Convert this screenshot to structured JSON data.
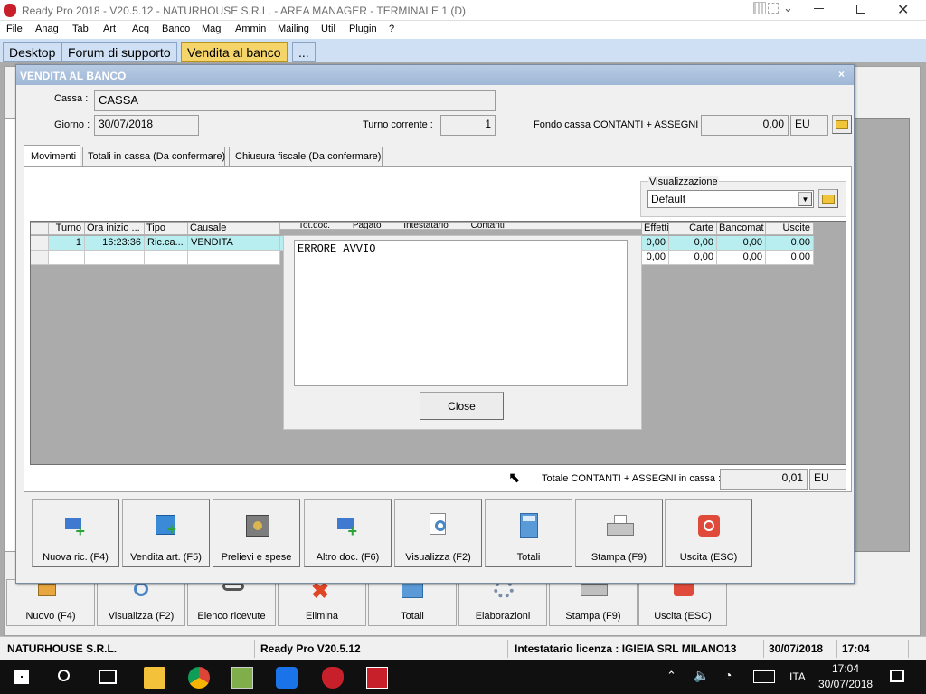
{
  "window": {
    "title": "Ready Pro 2018 - V20.5.12 - NATURHOUSE S.R.L. - AREA MANAGER - TERMINALE 1 (D)"
  },
  "menu": [
    "File",
    "Anag",
    "Tab",
    "Art",
    "Acq",
    "Banco",
    "Mag",
    "Ammin",
    "Mailing",
    "Util",
    "Plugin",
    "?"
  ],
  "tabs": [
    "Desktop",
    "Forum di supporto",
    "Vendita al banco",
    "..."
  ],
  "dialog": {
    "title": "VENDITA AL BANCO",
    "cassa_label": "Cassa :",
    "cassa_value": "CASSA",
    "giorno_label": "Giorno :",
    "giorno_value": "30/07/2018",
    "turno_label": "Turno corrente :",
    "turno_value": "1",
    "fondo_label": "Fondo cassa CONTANTI + ASSEGNI :",
    "fondo_value": "0,00",
    "fondo_currency": "EU",
    "subtabs": [
      "Movimenti",
      "Totali in cassa (Da confermare)",
      "Chiusura fiscale (Da confermare)"
    ],
    "visualizzazione_label": "Visualizzazione",
    "visualizzazione_value": "Default",
    "grid_headers_left": [
      "Turno",
      "Ora inizio ...",
      "Tipo",
      "Causale"
    ],
    "grid_headers_right": [
      "Effetti",
      "Carte",
      "Bancomat",
      "Uscite"
    ],
    "grid_headers_partial": [
      "Tot.doc.",
      "Pagato",
      "Intestatario",
      "Contanti"
    ],
    "row1": {
      "turno": "1",
      "ora": "16:23:36",
      "tipo": "Ric.ca...",
      "causale": "VENDITA",
      "effetti": "0,00",
      "carte": "0,00",
      "bancomat": "0,00",
      "uscite": "0,00"
    },
    "row2": {
      "effetti": "0,00",
      "carte": "0,00",
      "bancomat": "0,00",
      "uscite": "0,00"
    },
    "totale_label": "Totale CONTANTI + ASSEGNI in cassa :",
    "totale_value": "0,01",
    "totale_currency": "EU",
    "buttons": [
      "Nuova ric. (F4)",
      "Vendita art. (F5)",
      "Prelievi e spese",
      "Altro doc. (F6)",
      "Visualizza (F2)",
      "Totali",
      "Stampa (F9)",
      "Uscita (ESC)"
    ]
  },
  "error_popup": {
    "message": "ERRORE AVVIO",
    "close_label": "Close"
  },
  "back_buttons": [
    "Nuovo (F4)",
    "Visualizza (F2)",
    "Elenco ricevute",
    "Elimina",
    "Totali",
    "Elaborazioni",
    "Stampa (F9)",
    "Uscita (ESC)"
  ],
  "statusbar": {
    "company": "NATURHOUSE S.R.L.",
    "version": "Ready Pro V20.5.12",
    "license": "Intestatario licenza : IGIEIA SRL MILANO13",
    "date": "30/07/2018",
    "time": "17:04"
  },
  "taskbar": {
    "lang": "ITA",
    "time": "17:04",
    "date": "30/07/2018"
  },
  "colors": {
    "tab_active": "#f5d469",
    "dialog_title": "#9fb7d6",
    "grid_row_selected": "#b9eef0"
  }
}
